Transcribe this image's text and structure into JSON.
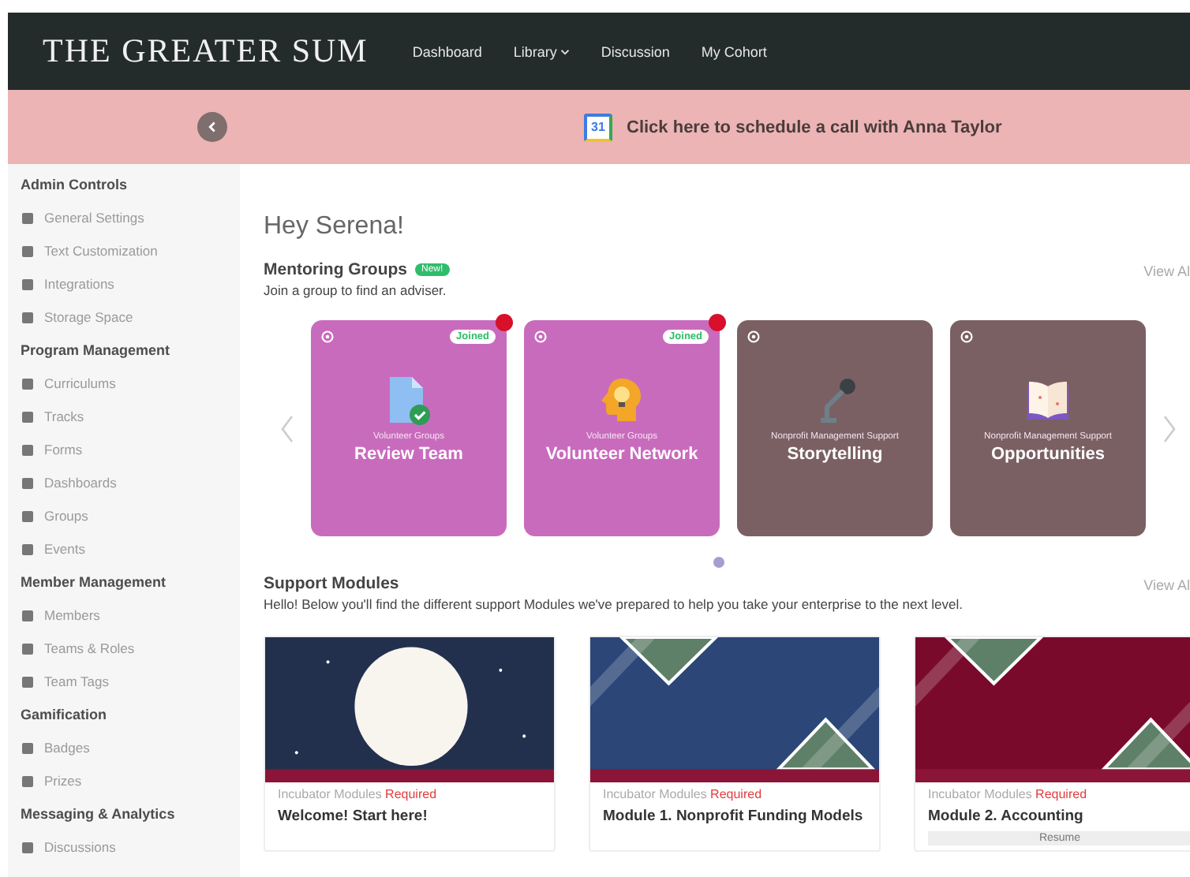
{
  "header": {
    "logo": "THE GREATER SUM",
    "nav": [
      {
        "label": "Dashboard",
        "dropdown": false
      },
      {
        "label": "Library",
        "dropdown": true
      },
      {
        "label": "Discussion",
        "dropdown": false
      },
      {
        "label": "My Cohort",
        "dropdown": false
      }
    ]
  },
  "banner": {
    "calendar_day": "31",
    "text": "Click here to schedule a call with Anna Taylor"
  },
  "sidebar": {
    "sections": [
      {
        "title": "Admin Controls",
        "items": [
          "General Settings",
          "Text Customization",
          "Integrations",
          "Storage Space"
        ]
      },
      {
        "title": "Program Management",
        "items": [
          "Curriculums",
          "Tracks",
          "Forms",
          "Dashboards",
          "Groups",
          "Events"
        ]
      },
      {
        "title": "Member Management",
        "items": [
          "Members",
          "Teams & Roles",
          "Team Tags"
        ]
      },
      {
        "title": "Gamification",
        "items": [
          "Badges",
          "Prizes"
        ]
      },
      {
        "title": "Messaging & Analytics",
        "items": [
          "Discussions"
        ]
      }
    ]
  },
  "greeting": "Hey Serena!",
  "mentoring": {
    "title": "Mentoring Groups",
    "badge": "New!",
    "subtitle": "Join a group to find an adviser.",
    "view_all": "View Al",
    "cards": [
      {
        "category": "Volunteer Groups",
        "name": "Review Team",
        "color": "#c96bbd",
        "joined": true,
        "joined_label": "Joined",
        "notification": true
      },
      {
        "category": "Volunteer Groups",
        "name": "Volunteer Network",
        "color": "#c96bbd",
        "joined": true,
        "joined_label": "Joined",
        "notification": true
      },
      {
        "category": "Nonprofit Management Support",
        "name": "Storytelling",
        "color": "#7b6063",
        "joined": false,
        "notification": false
      },
      {
        "category": "Nonprofit Management Support",
        "name": "Opportunities",
        "color": "#7b6063",
        "joined": false,
        "notification": false
      }
    ]
  },
  "support": {
    "title": "Support Modules",
    "view_all": "View Al",
    "subtitle": "Hello! Below you'll find the different support Modules we've prepared to help you take your enterprise to the next level.",
    "modules": [
      {
        "category": "Incubator Modules",
        "tag": "Required",
        "title": "Welcome! Start here!",
        "color": "#22304d"
      },
      {
        "category": "Incubator Modules",
        "tag": "Required",
        "title": "Module 1. Nonprofit Funding Models",
        "color": "#2b4677"
      },
      {
        "category": "Incubator Modules",
        "tag": "Required",
        "title": "Module 2. Accounting",
        "color": "#7a0a2c",
        "button": "Resume"
      }
    ]
  }
}
